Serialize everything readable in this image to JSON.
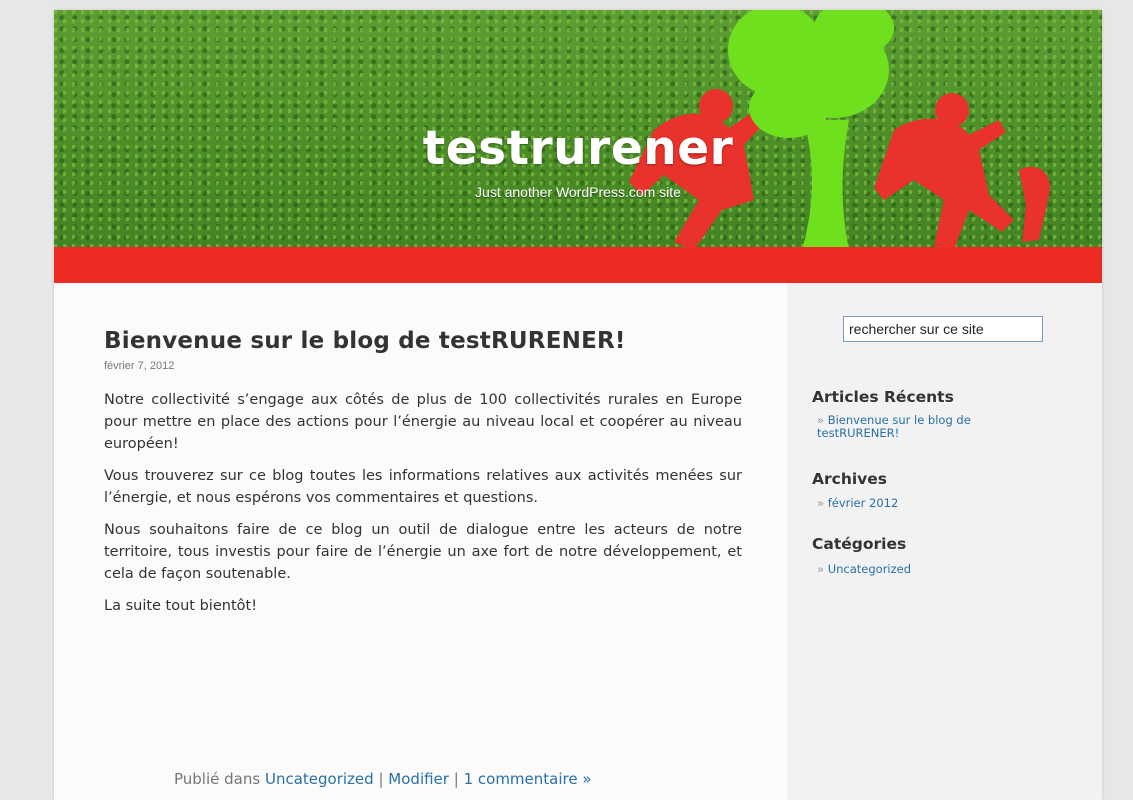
{
  "header": {
    "title": "testrurener",
    "description": "Just another WordPress.com site"
  },
  "post": {
    "title": "Bienvenue sur le blog de testRURENER!",
    "date": "février 7, 2012",
    "paragraphs": [
      "Notre collectivité s’engage aux côtés de plus de 100 collectivités rurales en Europe pour mettre en place des actions pour l’énergie au niveau local et coopérer au niveau européen!",
      "Vous trouverez sur ce blog toutes les informations relatives aux activités menées sur l’énergie, et nous espérons vos commentaires et questions.",
      "Nous souhaitons faire de ce blog un outil de dialogue entre les acteurs de notre territoire, tous investis pour faire de l’énergie un axe fort de notre développement, et cela de façon soutenable.",
      "La suite tout bientôt!"
    ],
    "meta": {
      "published_in": "Publié dans",
      "category": "Uncategorized",
      "sep1": "|",
      "edit": "Modifier",
      "sep2": "|",
      "comments": "1 commentaire »"
    }
  },
  "sidebar": {
    "search_value": "rechercher sur ce site",
    "recent_heading": "Articles Récents",
    "recent_items": [
      "Bienvenue sur le blog de testRURENER!"
    ],
    "archives_heading": "Archives",
    "archive_items": [
      "février 2012"
    ],
    "categories_heading": "Catégories",
    "category_items": [
      "Uncategorized"
    ],
    "bullet": "»"
  },
  "colors": {
    "page_bg": "#e7e7e7",
    "header_band": "#ee2a24",
    "link": "#2970a6",
    "text": "#333333"
  }
}
